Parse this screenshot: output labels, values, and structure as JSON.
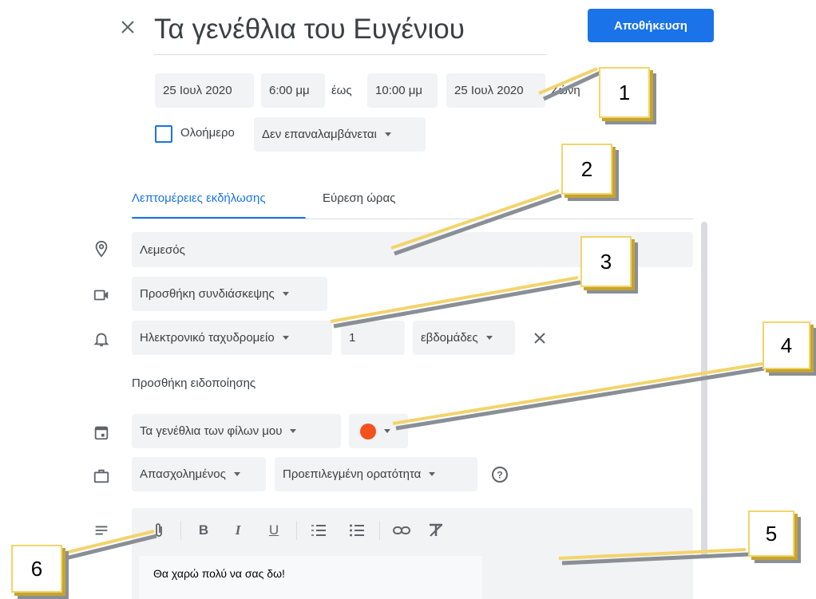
{
  "header": {
    "title": "Τα γενέθλια του Ευγένιου",
    "save_label": "Αποθήκευση"
  },
  "datetime": {
    "start_date": "25 Ιουλ 2020",
    "start_time": "6:00 μμ",
    "separator": "έως",
    "end_time": "10:00 μμ",
    "end_date": "25 Ιουλ 2020",
    "timezone_label": "Ζώνη"
  },
  "options": {
    "all_day_label": "Ολοήμερο",
    "repeat_label": "Δεν επαναλαμβάνεται"
  },
  "tabs": [
    {
      "label": "Λεπτομέρειες εκδήλωσης"
    },
    {
      "label": "Εύρεση ώρας"
    }
  ],
  "details": {
    "location": "Λεμεσός",
    "conference_label": "Προσθήκη συνδιάσκεψης",
    "notification_type": "Ηλεκτρονικό ταχυδρομείο",
    "notification_value": "1",
    "notification_unit": "εβδομάδες",
    "add_notification_label": "Προσθήκη ειδοποίησης",
    "calendar_label": "Τα γενέθλια των φίλων μου",
    "color": "#f4511e",
    "availability_label": "Απασχολημένος",
    "visibility_label": "Προεπιλεγμένη ορατότητα",
    "description": "Θα χαρώ πολύ να σας δω!"
  },
  "toolbar": {
    "bold": "B",
    "italic": "I",
    "underline": "U"
  },
  "callouts": [
    "1",
    "2",
    "3",
    "4",
    "5",
    "6"
  ]
}
